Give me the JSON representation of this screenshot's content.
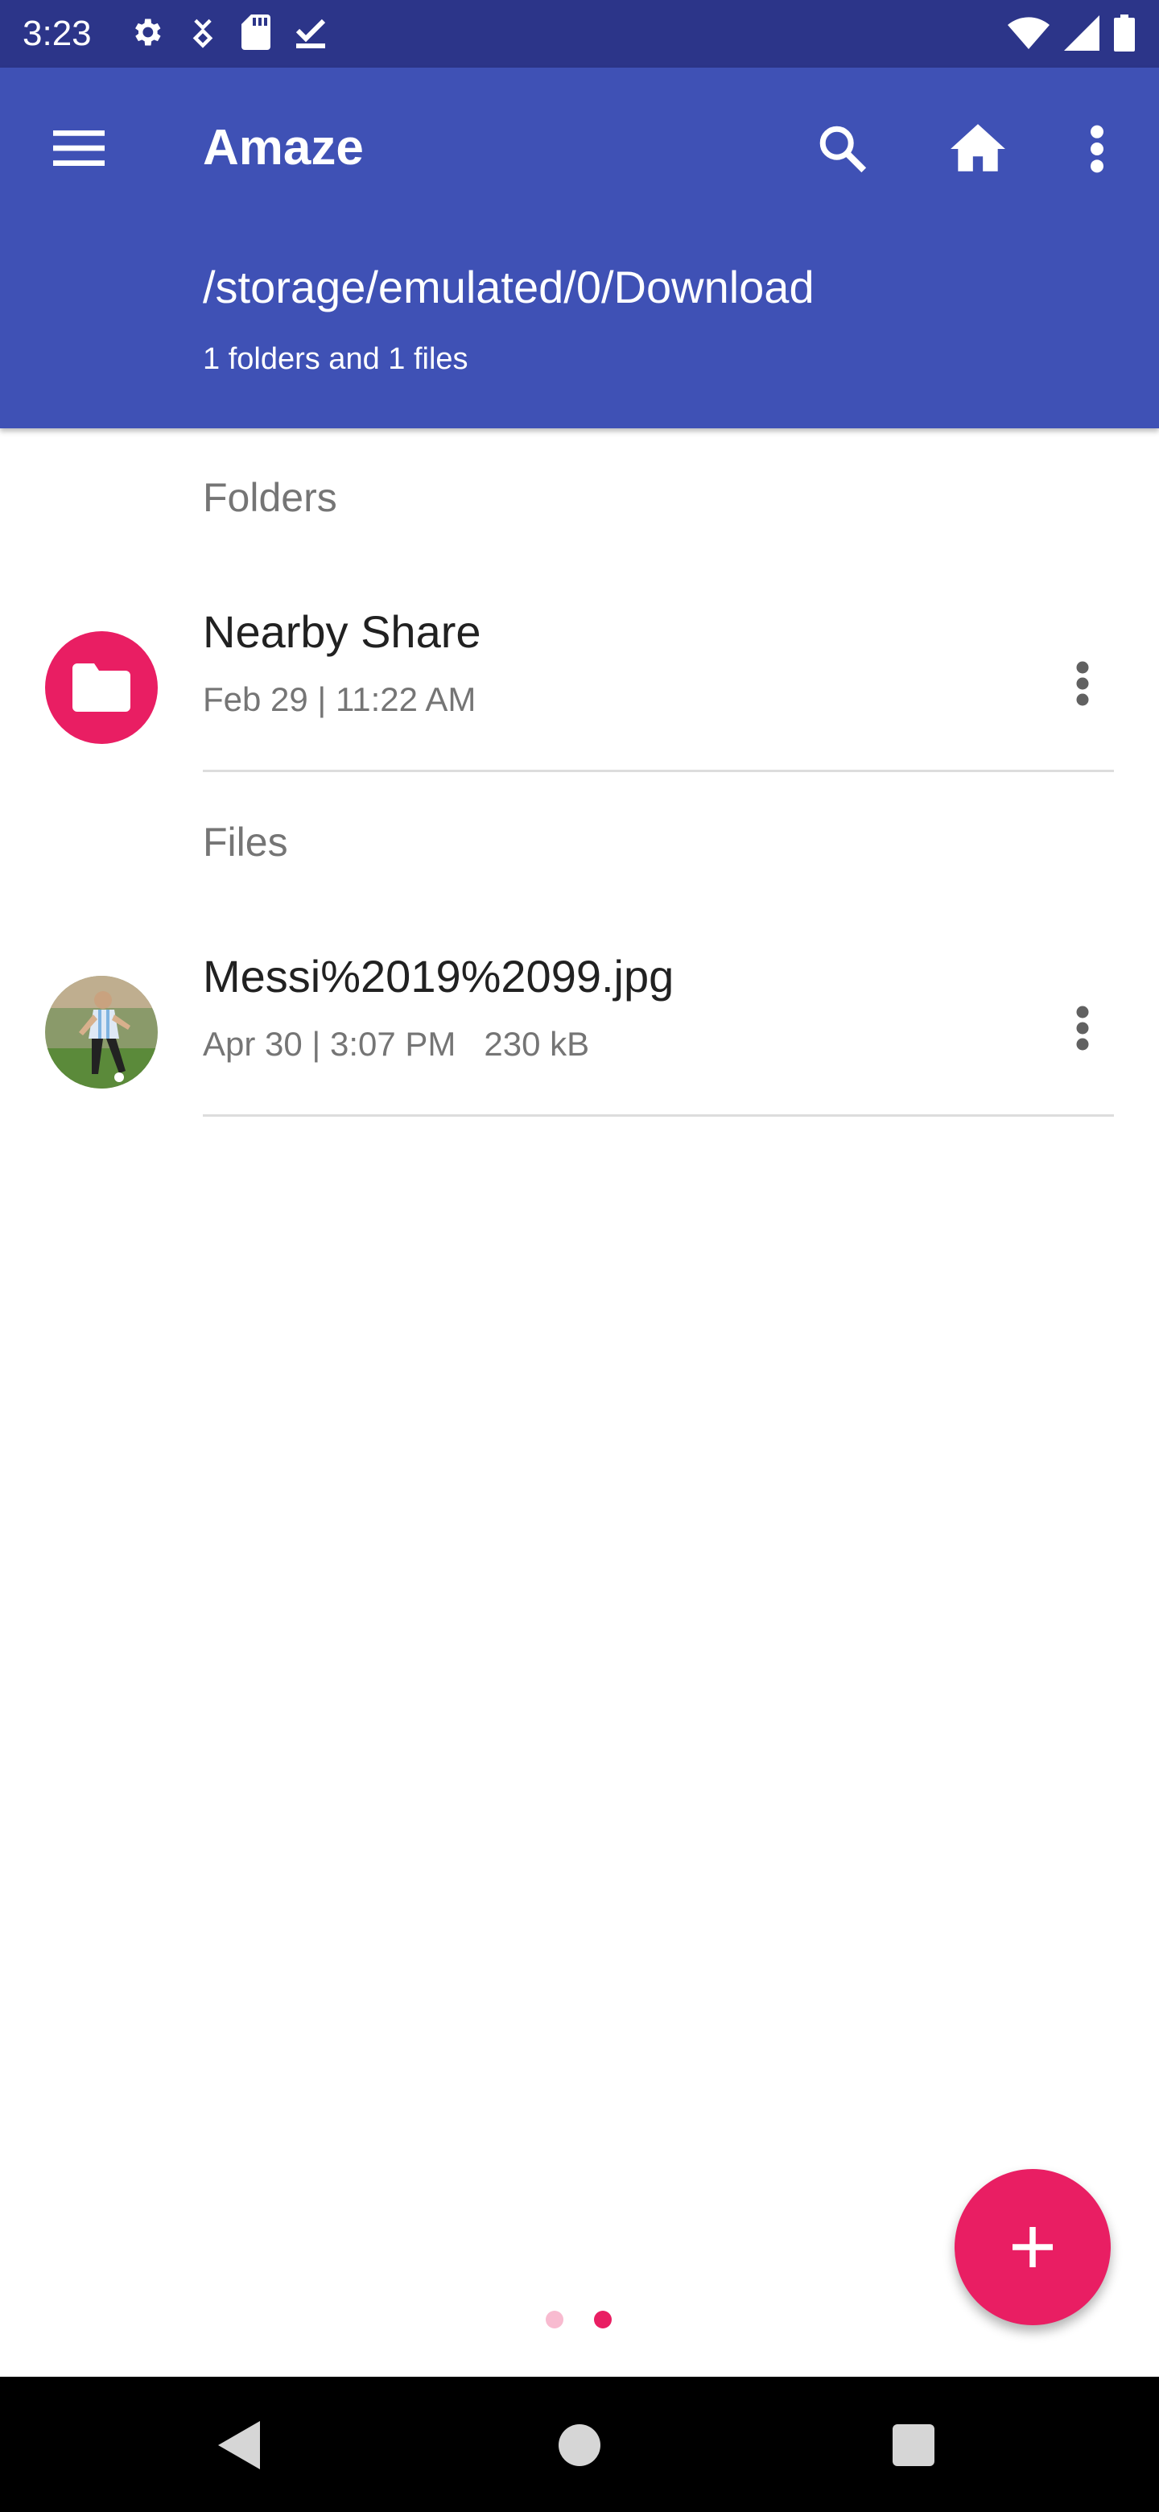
{
  "status_bar": {
    "time": "3:23",
    "left_icons": [
      "settings-icon",
      "data-saver-icon",
      "sd-card-icon",
      "download-done-icon"
    ],
    "right_icons": [
      "wifi-icon",
      "signal-icon",
      "battery-icon"
    ]
  },
  "toolbar": {
    "title": "Amaze",
    "path": "/storage/emulated/0/Download",
    "summary": "1 folders and 1 files",
    "icons": [
      "menu-icon",
      "search-icon",
      "home-icon",
      "more-vert-icon"
    ]
  },
  "folders": {
    "header": "Folders",
    "items": [
      {
        "name": "Nearby Share",
        "date": "Feb 29 | 11:22 AM",
        "size": ""
      }
    ]
  },
  "files": {
    "header": "Files",
    "items": [
      {
        "name": "Messi%2019%2099.jpg",
        "date": "Apr 30 | 3:07 PM",
        "size": "230 kB"
      }
    ]
  },
  "fab": {
    "icon": "plus-icon"
  },
  "pager": {
    "pages": 2,
    "active": 2
  },
  "colors": {
    "status_bar": "#2c3589",
    "primary": "#3f51b5",
    "accent": "#e91e63",
    "dot_inactive": "#f8bbd0"
  },
  "nav_bar": {
    "icons": [
      "back-icon",
      "home-circle-icon",
      "recents-icon"
    ]
  }
}
